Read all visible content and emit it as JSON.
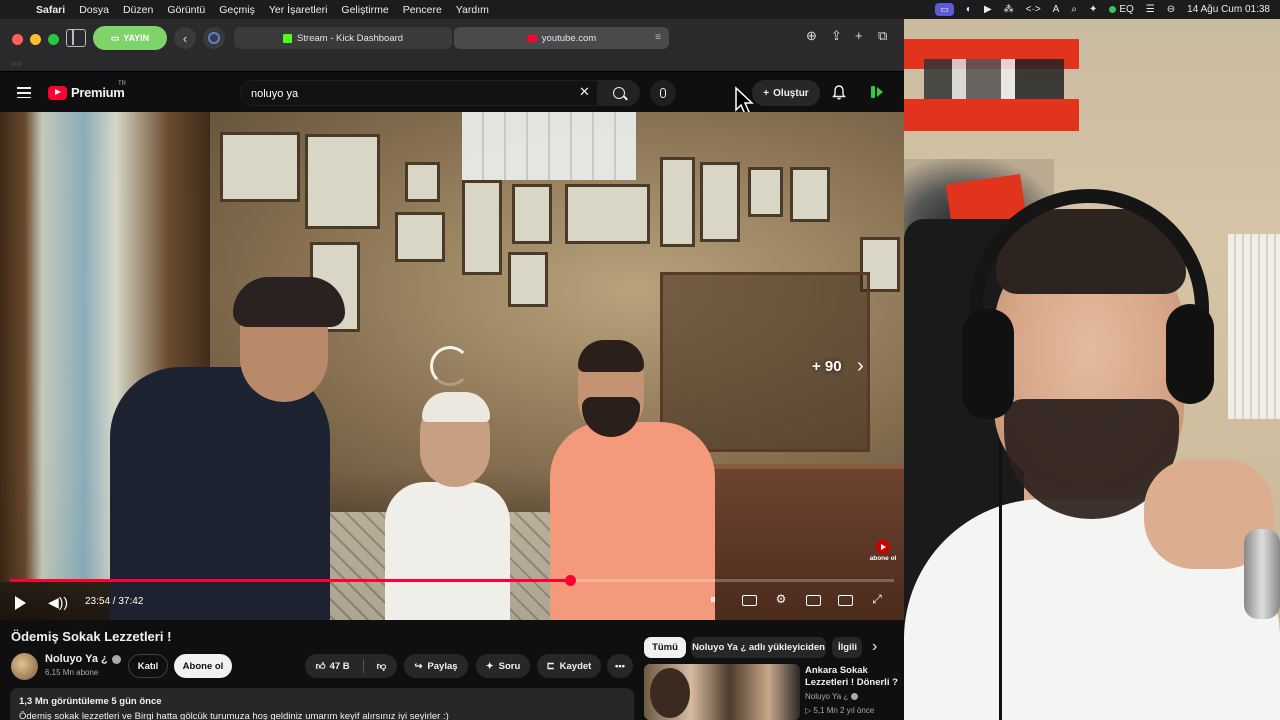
{
  "menubar": {
    "app": "Safari",
    "items": [
      "Dosya",
      "Düzen",
      "Görüntü",
      "Geçmiş",
      "Yer İşaretleri",
      "Geliştirme",
      "Pencere",
      "Yardım"
    ],
    "eq": "EQ",
    "datetime": "14 Ağu Cum  01:38"
  },
  "safari": {
    "stream_button": "YAYIN",
    "tabs": [
      {
        "title": "Stream - Kick Dashboard"
      },
      {
        "title": "youtube.com"
      }
    ]
  },
  "youtube": {
    "logo": "Premium",
    "logo_region": "TR",
    "search": {
      "value": "noluyo ya",
      "placeholder": "Ara"
    },
    "create_label": "Oluştur"
  },
  "player": {
    "skip_label": "+ 90",
    "time": "23:54 / 37:42",
    "progress": 0.633,
    "subscribe_watermark": "abone ol"
  },
  "video": {
    "title": "Ödemiş Sokak Lezzetleri !",
    "channel": "Noluyo Ya ¿",
    "subscribers": "6,15 Mn abone",
    "join_label": "Katıl",
    "subscribe_label": "Abone ol",
    "likes": "47 B",
    "share_label": "Paylaş",
    "ask_label": "Soru",
    "save_label": "Kaydet",
    "views_and_date": "1,3 Mn görüntüleme  5 gün önce",
    "description": "Ödemiş sokak lezzetleri ve Birgi hatta gölcük turumuza hoş geldiniz umarım keyif alırsınız iyi seyirler :)"
  },
  "recommendations": {
    "chips": [
      "Tümü",
      "Noluyo Ya ¿ adlı yükleyiciden",
      "İlgili"
    ],
    "items": [
      {
        "title": "Ankara Sokak Lezzetleri ! Dönerli ?",
        "channel": "Noluyo Ya ¿",
        "meta": "▷ 5,1 Mn   2 yıl önce"
      }
    ]
  },
  "colors": {
    "youtube_red": "#ff0033",
    "stream_green": "#7fd36b",
    "kick_green": "#53fc18"
  }
}
